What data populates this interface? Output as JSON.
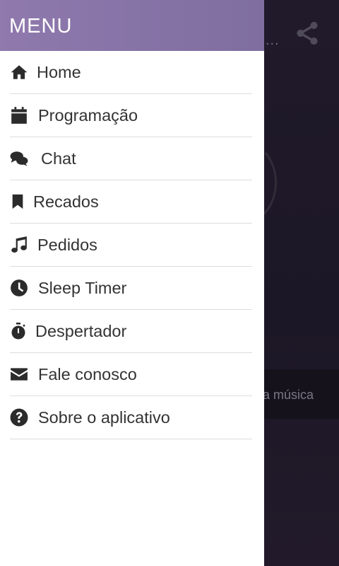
{
  "drawer": {
    "title": "MENU",
    "items": [
      {
        "label": "Home",
        "icon": "home-icon"
      },
      {
        "label": "Programação",
        "icon": "calendar-icon"
      },
      {
        "label": "Chat",
        "icon": "chat-bubbles-icon"
      },
      {
        "label": "Recados",
        "icon": "bookmark-icon"
      },
      {
        "label": "Pedidos",
        "icon": "music-note-icon"
      },
      {
        "label": "Sleep Timer",
        "icon": "clock-icon"
      },
      {
        "label": "Despertador",
        "icon": "stopwatch-icon"
      },
      {
        "label": "Fale conosco",
        "icon": "envelope-icon"
      },
      {
        "label": "Sobre o aplicativo",
        "icon": "question-circle-icon"
      }
    ]
  },
  "background": {
    "dots": "...",
    "now_playing_text": "a música"
  },
  "colors": {
    "header_gradient_start": "#8f79ad",
    "header_gradient_end": "#7f6ea0",
    "icon": "#2b2b2b",
    "text": "#333333"
  }
}
